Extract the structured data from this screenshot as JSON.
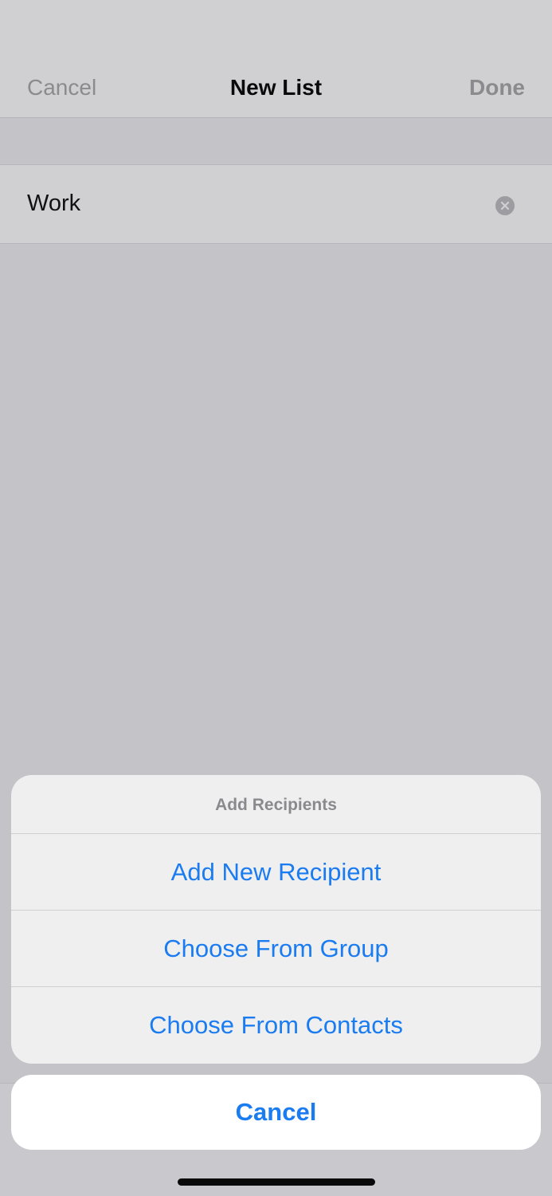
{
  "nav": {
    "cancel_label": "Cancel",
    "title": "New List",
    "done_label": "Done"
  },
  "list_name": {
    "value": "Work",
    "clear_icon": "clear-circle-icon"
  },
  "action_sheet": {
    "title": "Add Recipients",
    "actions": [
      "Add New Recipient",
      "Choose From Group",
      "Choose From Contacts"
    ],
    "cancel_label": "Cancel"
  },
  "colors": {
    "accent": "#1a7cf0",
    "dimmed_text": "#8b8b8f"
  }
}
